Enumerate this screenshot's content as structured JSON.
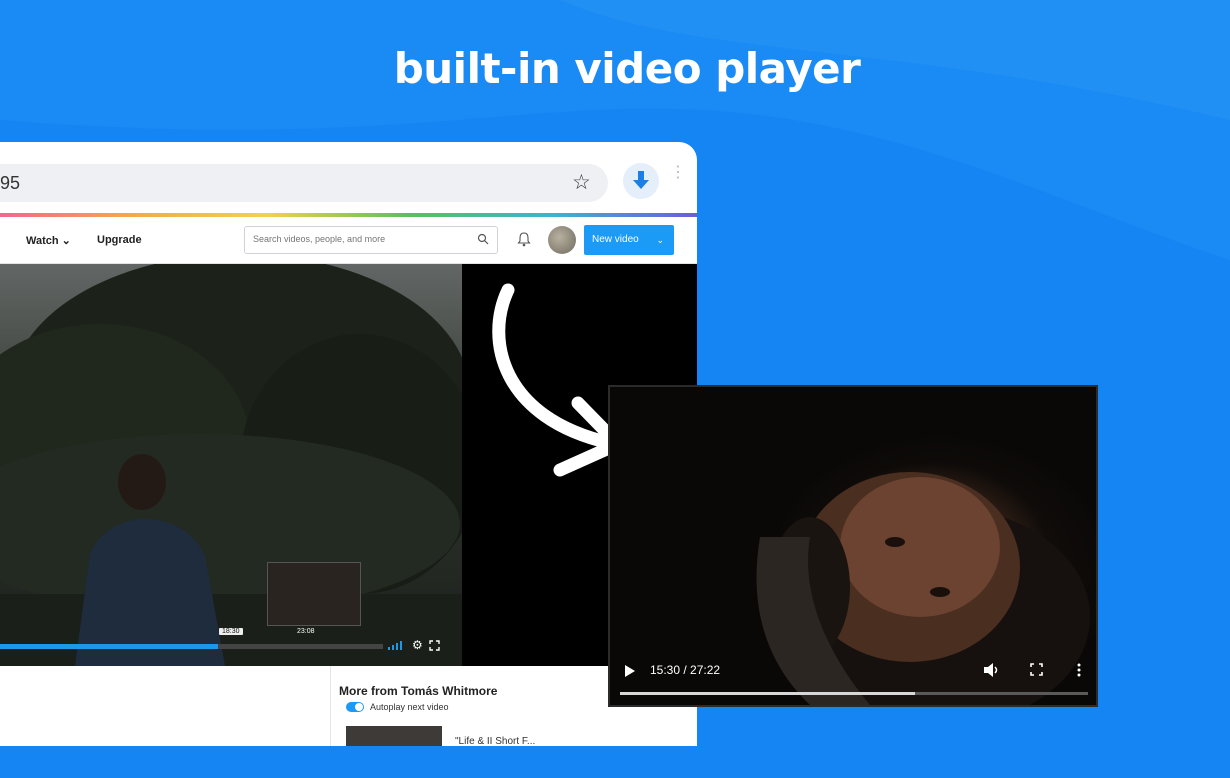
{
  "headline": "built-in video player",
  "colors": {
    "background": "#1485f3",
    "accent": "#1b9af6"
  },
  "browser": {
    "url_text": "95",
    "bookmark_icon": "star-icon",
    "download_icon": "download-arrow-icon"
  },
  "nav": {
    "watch_label": "Watch",
    "upgrade_label": "Upgrade",
    "search_placeholder": "Search videos, people, and more",
    "new_video_label": "New video"
  },
  "main_player": {
    "time_tooltip": "18:30",
    "preview_time": "23:08",
    "progress_fraction": 0.59
  },
  "sidebar": {
    "more_from_title": "More from Tomás Whitmore",
    "autoplay_label": "Autoplay next video",
    "autoplay_on": true,
    "related_title": "\"Life & II Short F..."
  },
  "popout_player": {
    "time_display": "15:30 / 27:22",
    "progress_fraction": 0.63
  }
}
